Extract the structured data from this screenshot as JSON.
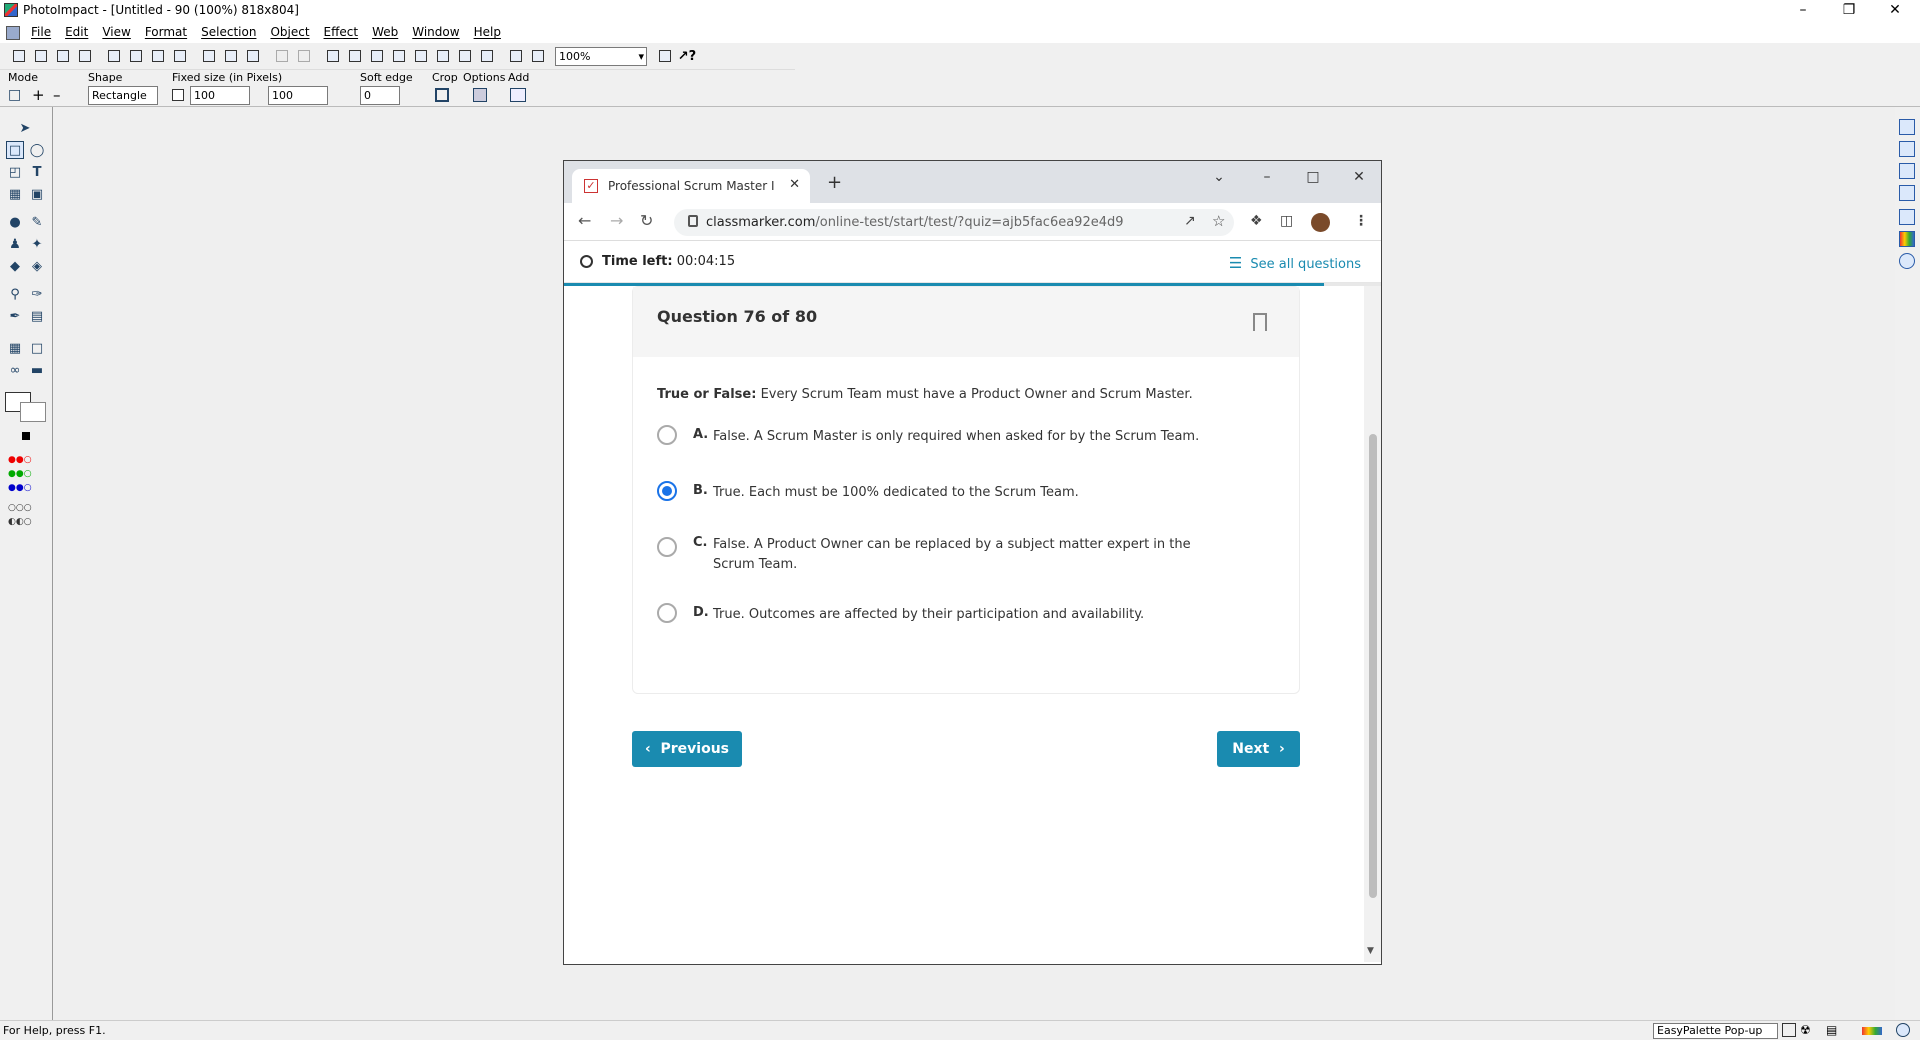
{
  "app": {
    "title": "PhotoImpact - [Untitled - 90 (100%) 818x804]",
    "menu": [
      "File",
      "Edit",
      "View",
      "Format",
      "Selection",
      "Object",
      "Effect",
      "Web",
      "Window",
      "Help"
    ],
    "zoom": "100%",
    "mode_label": "Mode",
    "shape_label": "Shape",
    "shape_value": "Rectangle",
    "fixed_size_label": "Fixed size (in Pixels)",
    "width_value": "100",
    "height_value": "100",
    "soft_edge_label": "Soft edge",
    "soft_edge_value": "0",
    "crop_label": "Crop",
    "options_label": "Options",
    "add_label": "Add",
    "status": "For Help, press F1.",
    "palette": "EasyPalette Pop-up"
  },
  "browser": {
    "tab_title": "Professional Scrum Master I (PSM",
    "url_domain": "classmarker.com",
    "url_path": "/online-test/start/test/?quiz=ajb5fac6ea92e4d9"
  },
  "quiz": {
    "time_left_label": "Time left:",
    "time_left": "00:04:15",
    "see_all": "See all questions",
    "question_number": "Question 76 of 80",
    "question_prefix": "True or False:",
    "question_text": "Every Scrum Team must have a Product Owner and Scrum Master.",
    "options": [
      {
        "letter": "A.",
        "text": "False. A Scrum Master is only required when asked for by the Scrum Team.",
        "selected": false
      },
      {
        "letter": "B.",
        "text": "True. Each must be 100% dedicated to the Scrum Team.",
        "selected": true
      },
      {
        "letter": "C.",
        "text": "False. A Product Owner can be replaced by a subject matter expert in the Scrum Team.",
        "selected": false
      },
      {
        "letter": "D.",
        "text": "True. Outcomes are affected by their participation and availability.",
        "selected": false
      }
    ],
    "previous_label": "Previous",
    "next_label": "Next"
  },
  "colors": {
    "accent": "#1a8bb0",
    "radio_selected": "#1a73e8"
  }
}
